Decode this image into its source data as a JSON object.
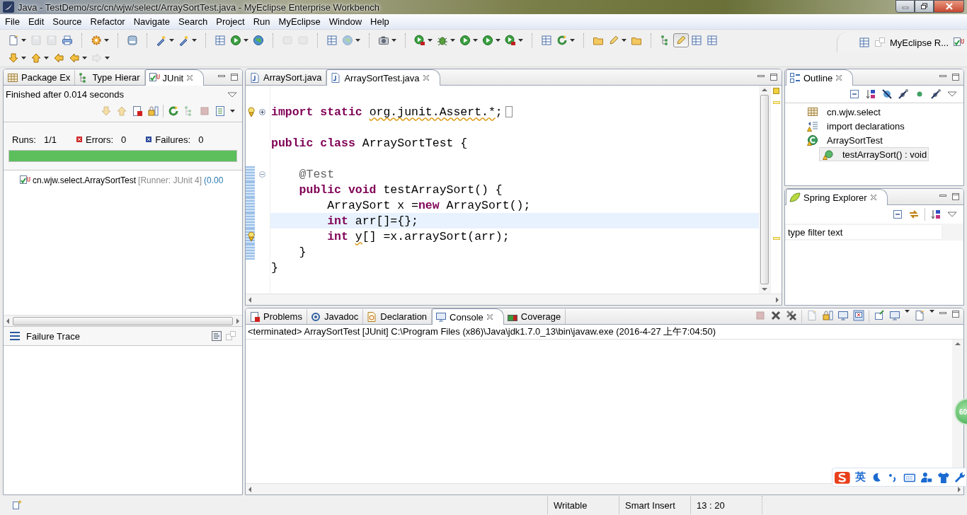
{
  "window": {
    "title": "Java - TestDemo/src/cn/wjw/select/ArraySortTest.java - MyEclipse Enterprise Workbench"
  },
  "menu": [
    "File",
    "Edit",
    "Source",
    "Refactor",
    "Navigate",
    "Search",
    "Project",
    "Run",
    "MyEclipse",
    "Window",
    "Help"
  ],
  "toolbar": {
    "perspective": "MyEclipse R..."
  },
  "left_view": {
    "tabs": [
      {
        "label": "Package Ex",
        "selected": false
      },
      {
        "label": "Type Hierar",
        "selected": false
      },
      {
        "label": "JUnit",
        "selected": true
      }
    ],
    "status": "Finished after 0.014 seconds",
    "counters": [
      {
        "kind": "runs",
        "label": "Runs:",
        "value": "1/1"
      },
      {
        "kind": "errors",
        "label": "Errors:",
        "value": "0"
      },
      {
        "kind": "failures",
        "label": "Failures:",
        "value": "0"
      }
    ],
    "progress": {
      "level": 1,
      "passed": true
    },
    "tests": [
      {
        "name": "cn.wjw.select.ArraySortTest",
        "runner": "[Runner: JUnit 4]",
        "time": "(0.00",
        "passed": true
      }
    ],
    "failure_trace": {
      "title": "Failure Trace"
    }
  },
  "editor": {
    "tabs": [
      {
        "label": "ArraySort.java",
        "selected": false
      },
      {
        "label": "ArraySortTest.java",
        "selected": true
      }
    ],
    "lines": [
      {
        "tokens": [
          {
            "kind": "keyword",
            "text": "import "
          },
          {
            "kind": "keyword",
            "text": "static "
          },
          {
            "kind": "warning",
            "text": "org.junit.Assert.*"
          },
          {
            "kind": "plain",
            "text": ";"
          }
        ],
        "collapsed": true,
        "warning": true,
        "current": false
      },
      {
        "current": false
      },
      {
        "tokens": [
          {
            "kind": "keyword",
            "text": "public class "
          },
          {
            "kind": "plain",
            "text": "ArraySortTest {"
          }
        ],
        "current": false
      },
      {
        "current": false
      },
      {
        "tokens": [
          {
            "kind": "annotation",
            "text": "    @Test"
          }
        ],
        "collapsed": false,
        "changed": true,
        "current": false
      },
      {
        "tokens": [
          {
            "kind": "keyword",
            "text": "    public void "
          },
          {
            "kind": "plain",
            "text": "testArraySort() {"
          }
        ],
        "changed": true,
        "current": false
      },
      {
        "tokens": [
          {
            "kind": "plain",
            "text": "        ArraySort x ="
          },
          {
            "kind": "keyword",
            "text": "new"
          },
          {
            "kind": "plain",
            "text": " ArraySort();"
          }
        ],
        "changed": true,
        "current": false
      },
      {
        "tokens": [
          {
            "kind": "keyword",
            "text": "        int "
          },
          {
            "kind": "plain",
            "text": "arr[]={};"
          }
        ],
        "changed": true,
        "current": true
      },
      {
        "tokens": [
          {
            "kind": "keyword",
            "text": "        int "
          },
          {
            "kind": "warning",
            "text": "y"
          },
          {
            "kind": "plain",
            "text": "[] =x.arraySort(arr);"
          }
        ],
        "warning": true,
        "changed": true,
        "current": false
      },
      {
        "tokens": [
          {
            "kind": "plain",
            "text": "    }"
          }
        ],
        "changed": true,
        "current": false
      },
      {
        "tokens": [
          {
            "kind": "plain",
            "text": "}"
          }
        ],
        "current": false
      }
    ]
  },
  "outline": {
    "tabs": [
      {
        "label": "Outline",
        "selected": true
      }
    ],
    "items": [
      {
        "kind": "package",
        "label": "cn.wjw.select",
        "warning": false,
        "selected": false
      },
      {
        "kind": "imports",
        "label": "import declarations",
        "warning": true,
        "selected": false
      },
      {
        "kind": "class",
        "label": "ArraySortTest",
        "warning": true,
        "selected": false,
        "children": [
          {
            "kind": "method",
            "label": "testArraySort() : void",
            "warning": true,
            "selected": true
          }
        ]
      }
    ]
  },
  "spring_explorer": {
    "tabs": [
      {
        "label": "Spring Explorer",
        "selected": true
      }
    ],
    "filter": {
      "placeholder": "type filter text"
    }
  },
  "console_view": {
    "tabs": [
      {
        "label": "Problems",
        "selected": false
      },
      {
        "label": "Javadoc",
        "selected": false
      },
      {
        "label": "Declaration",
        "selected": false
      },
      {
        "label": "Console",
        "selected": true
      },
      {
        "label": "Coverage",
        "selected": false
      }
    ],
    "header": "<terminated> ArraySortTest [JUnit] C:\\Program Files (x86)\\Java\\jdk1.7.0_13\\bin\\javaw.exe (2016-4-27 上午7:04:50)"
  },
  "ime_bar": {
    "mode": "英"
  },
  "speed_badge": "60",
  "status_bar": {
    "fields": [
      "Writable",
      "Smart Insert",
      "13 : 20"
    ]
  }
}
